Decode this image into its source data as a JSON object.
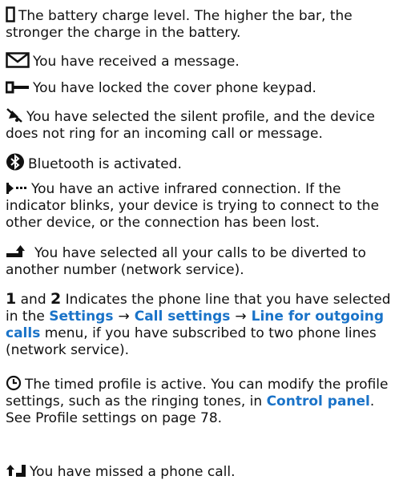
{
  "colors": {
    "text": "#111111",
    "link": "#1a73c8"
  },
  "entries": [
    {
      "icon": "battery-level-icon",
      "text": "The battery charge level. The higher the bar, the stronger the charge in the battery."
    },
    {
      "icon": "message-envelope-icon",
      "text": "You have received a message."
    },
    {
      "icon": "key-icon",
      "text": "You have locked the cover phone keypad."
    },
    {
      "icon": "silent-bell-icon",
      "text": "You have selected the silent profile, and the device does not ring for an incoming call or message."
    },
    {
      "icon": "bluetooth-icon",
      "text": "Bluetooth is activated."
    },
    {
      "icon": "infrared-icon",
      "text": "You have an active infrared connection. If the indicator blinks, your device is trying to connect to the other device, or the connection has been lost."
    },
    {
      "icon": "call-divert-arrow-icon",
      "text": "You have selected all your calls to be diverted to another number (network service)."
    },
    {
      "icon": "line-number-icon",
      "line1": "1",
      "and": "and",
      "line2": "2",
      "text_a": "Indicates the phone line that you have selected in the",
      "link_settings": "Settings",
      "arrow1": "→",
      "link_call_settings": "Call settings",
      "arrow2": "→",
      "link_line": "Line for outgoing calls",
      "text_b": "menu, if you have subscribed to two phone lines (network service)."
    },
    {
      "icon": "clock-icon",
      "text_a": "The timed profile is active. You can modify the profile settings, such as the ringing tones, in",
      "link_control_panel": "Control panel",
      "text_b": ". See Profile settings on page 78."
    },
    {
      "icon": "missed-call-icon",
      "text": "You have missed a phone call."
    }
  ]
}
